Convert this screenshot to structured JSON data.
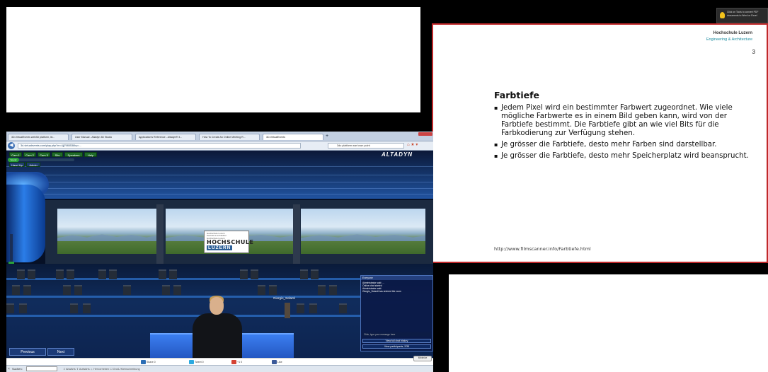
{
  "slide": {
    "logo_line1": "Hochschule Luzern",
    "logo_line2": "Engineering & Architecture",
    "page_number": "3",
    "title": "Farbtiefe",
    "bullets": [
      "Jedem Pixel wird ein bestimmter Farbwert zugeordnet. Wie viele mögliche Farbwerte es in einem Bild geben kann, wird von der Farbtiefe bestimmt. Die Farbtiefe gibt an wie viel Bits für die Farbkodierung zur Verfügung stehen.",
      "Je grösser die Farbtiefe, desto mehr Farben sind darstellbar.",
      "Je grösser die Farbtiefe, desto mehr Speicherplatz wird beansprucht."
    ],
    "footer_url": "http://www.filmscanner.info/Farbtiefe.html"
  },
  "tip": {
    "text": "Click on Tools to convert PDF documents to Word or Excel"
  },
  "browser": {
    "tabs": [
      "3D-VirtualEvents web3D platform, liv...",
      "User Manual - Altadyn 3D Studio",
      "Application's Reference - Altadyn® 3...",
      "How To Create An Online Meeting R...",
      "3D-VirtualEvents"
    ],
    "new_tab": "+",
    "url": "3d-virtualevents.com/play.php?m=4jj7985538hp=...",
    "search_text": "3do platform war town point",
    "back": "◀",
    "nav_icons": "⌂ ★ ▾"
  },
  "game": {
    "toolbar": [
      "Cam 1",
      "Cam 2",
      "Cam 3",
      "Sits",
      "Speakers",
      "Help"
    ],
    "slider_label": "Sound",
    "toolbar2": [
      "Hand Up",
      "Admin"
    ],
    "brand": "ALTADYN",
    "sign_small": "Hochschule Luzern\nTechnik & Architektur\nHochschule Luzern",
    "sign_big": "HOCHSCHULE",
    "sign_big2": "LUZERN",
    "other_avatar_name": "Giorgio_Solanti",
    "chat": {
      "header": "Everyone",
      "messages": [
        "Administrator said: ...",
        "Online chat started",
        "Administrator said:",
        "Giorgio_Solanti has entered the room"
      ],
      "input_placeholder": "Click, type your message here",
      "history_button": "View full chat history",
      "participants_button": "View participants, 2/35"
    },
    "previous": "Previous",
    "next": "Next"
  },
  "sharebar": {
    "items": [
      {
        "label": "Share",
        "count": "0",
        "color": "#2a6db5"
      },
      {
        "label": "Tweet",
        "count": "0",
        "color": "#2aa9e0"
      },
      {
        "label": "+1",
        "count": "0",
        "color": "#d44132"
      },
      {
        "label": "Like",
        "count": "",
        "color": "#3b5998"
      }
    ],
    "minimize": "Minimize"
  },
  "findbar": {
    "close": "×",
    "label": "Suchen:",
    "options": "⇩ Abwärts   ⇧ Aufwärts   ☼ Hervorheben   ☐ Groß-/Kleinschreibung"
  }
}
